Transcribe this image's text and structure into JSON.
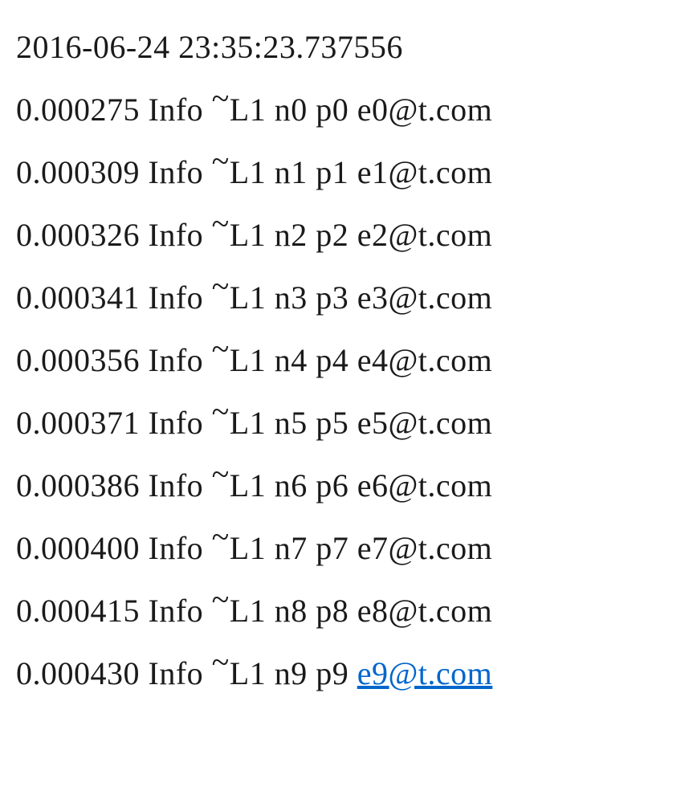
{
  "header": "2016-06-24 23:35:23.737556",
  "rows": [
    {
      "time": "0.000275",
      "level": "Info",
      "tag": "L1",
      "n": "n0",
      "p": "p0",
      "email": "e0@t.com",
      "is_link": false
    },
    {
      "time": "0.000309",
      "level": "Info",
      "tag": "L1",
      "n": "n1",
      "p": "p1",
      "email": "e1@t.com",
      "is_link": false
    },
    {
      "time": "0.000326",
      "level": "Info",
      "tag": "L1",
      "n": "n2",
      "p": "p2",
      "email": "e2@t.com",
      "is_link": false
    },
    {
      "time": "0.000341",
      "level": "Info",
      "tag": "L1",
      "n": "n3",
      "p": "p3",
      "email": "e3@t.com",
      "is_link": false
    },
    {
      "time": "0.000356",
      "level": "Info",
      "tag": "L1",
      "n": "n4",
      "p": "p4",
      "email": "e4@t.com",
      "is_link": false
    },
    {
      "time": "0.000371",
      "level": "Info",
      "tag": "L1",
      "n": "n5",
      "p": "p5",
      "email": "e5@t.com",
      "is_link": false
    },
    {
      "time": "0.000386",
      "level": "Info",
      "tag": "L1",
      "n": "n6",
      "p": "p6",
      "email": "e6@t.com",
      "is_link": false
    },
    {
      "time": "0.000400",
      "level": "Info",
      "tag": "L1",
      "n": "n7",
      "p": "p7",
      "email": "e7@t.com",
      "is_link": false
    },
    {
      "time": "0.000415",
      "level": "Info",
      "tag": "L1",
      "n": "n8",
      "p": "p8",
      "email": "e8@t.com",
      "is_link": false
    },
    {
      "time": "0.000430",
      "level": "Info",
      "tag": "L1",
      "n": "n9",
      "p": "p9",
      "email": "e9@t.com",
      "is_link": true
    }
  ]
}
